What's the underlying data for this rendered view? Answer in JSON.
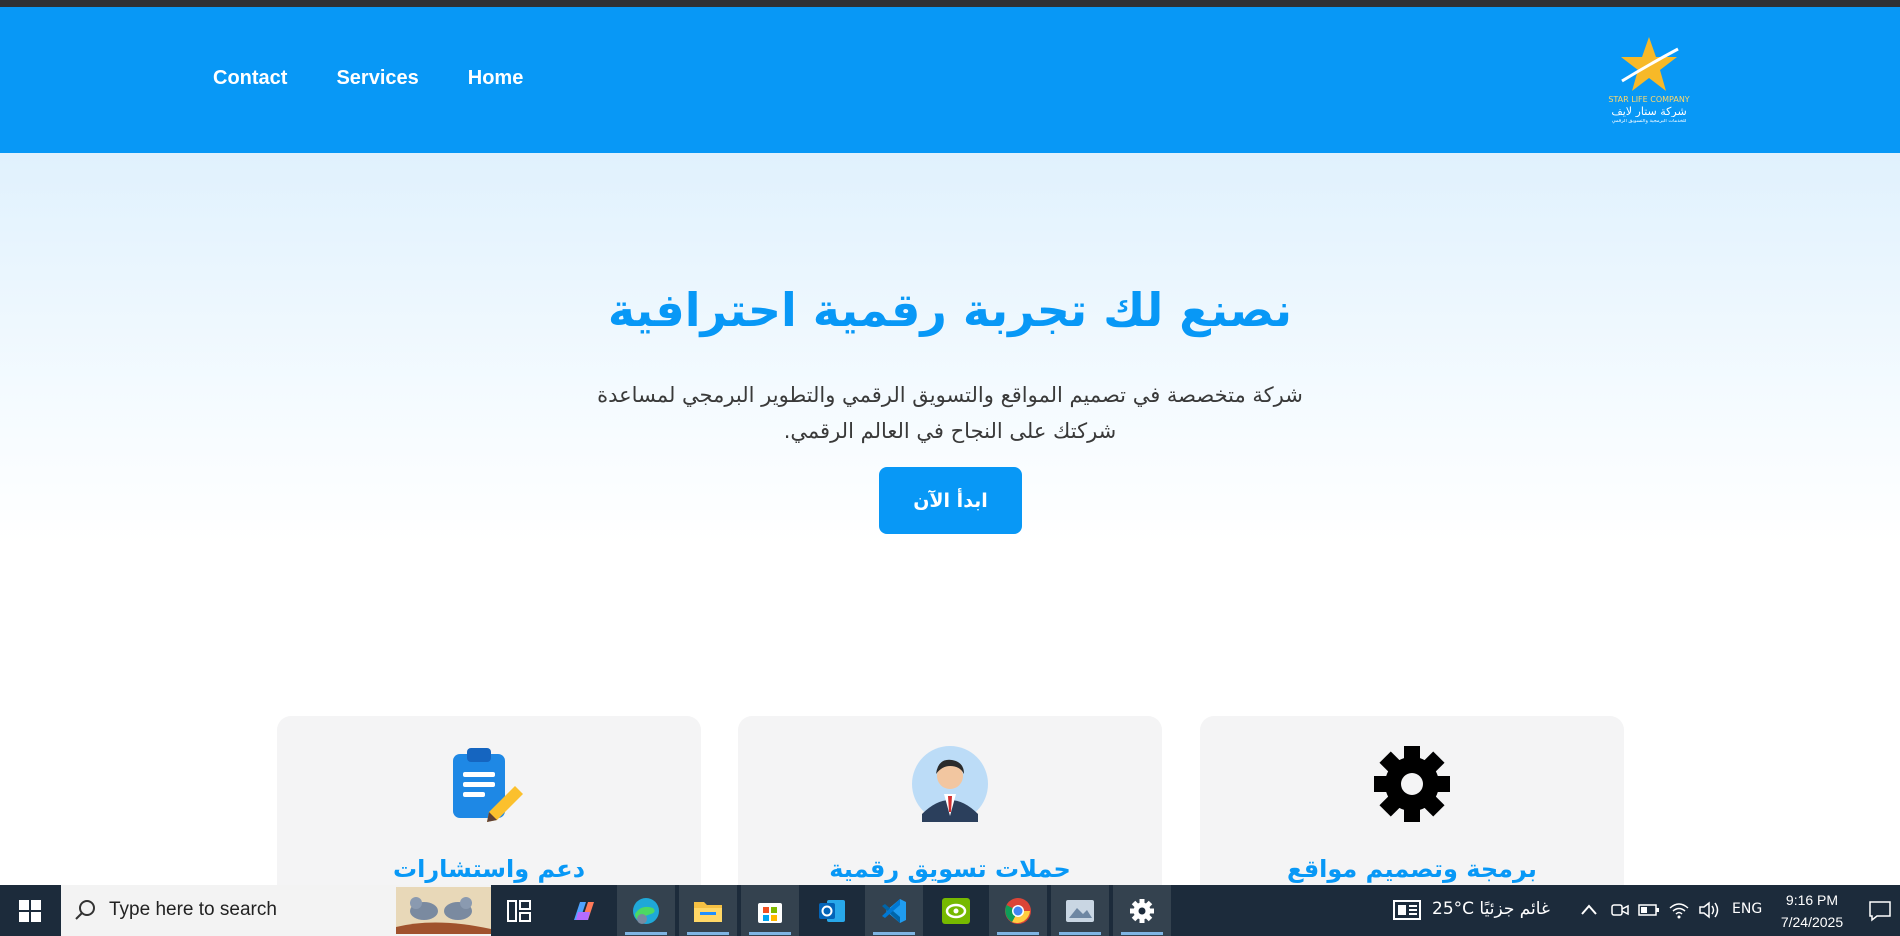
{
  "nav": {
    "links": [
      "Contact",
      "Services",
      "Home"
    ]
  },
  "logo": {
    "line1": "STAR LIFE COMPANY",
    "line2": "شركة ستار لايف",
    "line3": "للخدمات البرمجية والتسويق الرقمي"
  },
  "hero": {
    "title": "نصنع لك تجربة رقمية احترافية",
    "desc_line1": "شركة متخصصة في تصميم المواقع والتسويق الرقمي والتطوير البرمجي لمساعدة",
    "desc_line2": "شركتك على النجاح في العالم الرقمي.",
    "cta": "ابدأ الآن"
  },
  "services": [
    {
      "title": "دعم واستشارات",
      "icon": "clipboard-edit-icon"
    },
    {
      "title": "حملات تسويق رقمية",
      "icon": "businessman-avatar-icon"
    },
    {
      "title": "برمجة وتصميم مواقع",
      "icon": "gear-icon"
    }
  ],
  "taskbar": {
    "search_placeholder": "Type here to search",
    "weather": "25°C  غائم جزئيًا",
    "lang": "ENG",
    "time": "9:16 PM",
    "date": "7/24/2025"
  },
  "colors": {
    "brand": "#0898f6",
    "taskbar": "#1c2b3b",
    "card": "#f4f4f5"
  }
}
